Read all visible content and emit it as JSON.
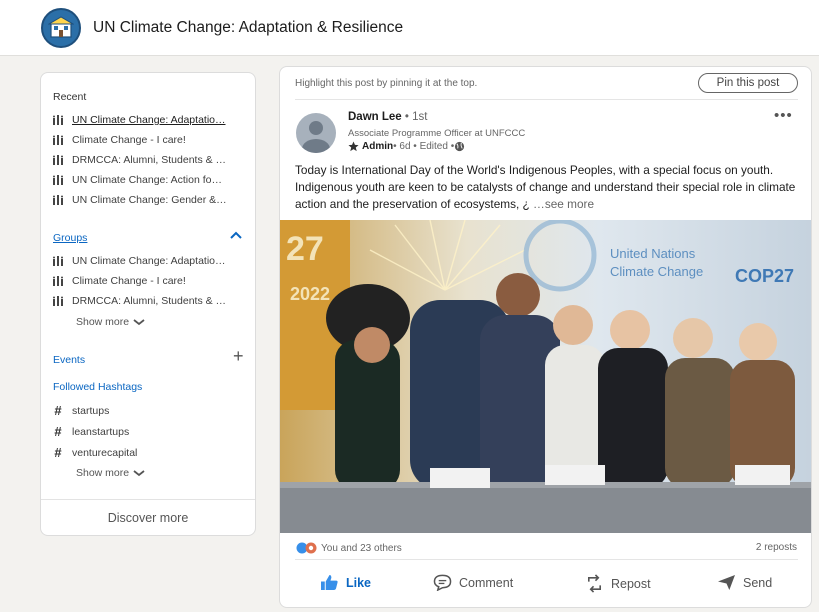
{
  "header": {
    "group_title": "UN Climate Change: Adaptation & Resilience"
  },
  "sidebar": {
    "recent_label": "Recent",
    "recent_items": [
      "UN Climate Change: Adaptatio…",
      "Climate Change - I care!",
      "DRMCCA: Alumni, Students & …",
      "UN Climate Change: Action fo…",
      "UN Climate Change: Gender &…"
    ],
    "groups_label": "Groups",
    "group_items": [
      "UN Climate Change: Adaptatio…",
      "Climate Change - I care!",
      "DRMCCA: Alumni, Students & …"
    ],
    "show_more": "Show more",
    "events_label": "Events",
    "hashtags_label": "Followed Hashtags",
    "hashtags": [
      "startups",
      "leanstartups",
      "venturecapital"
    ],
    "discover": "Discover more"
  },
  "post": {
    "highlight_text": "Highlight this post by pinning it at the top.",
    "pin_label": "Pin this post",
    "author_name": "Dawn Lee",
    "author_degree": " • 1st",
    "author_title": "Associate Programme Officer at UNFCCC",
    "admin_label": "Admin",
    "meta_text": " • 6d • Edited • ",
    "body": "Today is International Day of the World's Indigenous Peoples, with a special focus on youth. Indigenous youth are keen to be catalysts of change and understand their special role in climate action and the preservation of ecosystems, ¿",
    "see_more": " …see more",
    "photo_banner_text": "United Nations",
    "photo_banner_text2": "Climate Change",
    "photo_cop": "COP27",
    "photo_year": "2022",
    "photo_left_num": "27",
    "reactions_text": "You and 23 others",
    "reposts_text": "2 reposts"
  },
  "actions": {
    "like": "Like",
    "comment": "Comment",
    "repost": "Repost",
    "send": "Send"
  },
  "colors": {
    "accent": "#0a66c2",
    "background": "#f3f2ef",
    "card": "#ffffff"
  },
  "icons": [
    "group-logo-icon",
    "groups-icon",
    "hashtag-icon",
    "chevron-down-icon",
    "chevron-up-icon",
    "plus-icon",
    "globe-icon",
    "star-icon",
    "more-icon",
    "like-icon",
    "comment-icon",
    "repost-icon",
    "send-icon",
    "reaction-icon"
  ]
}
